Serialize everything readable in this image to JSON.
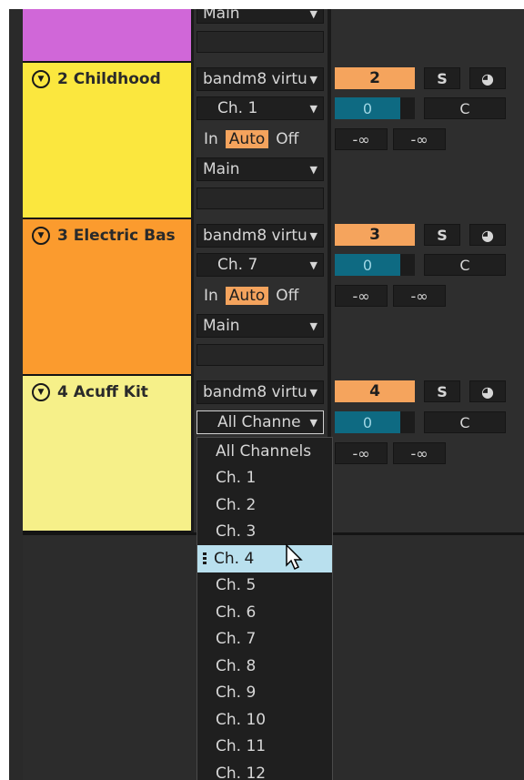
{
  "colors": {
    "track1": "#d067d8",
    "track2": "#fbe73e",
    "track3": "#fb9b2e",
    "track4": "#f6f089",
    "accent": "#f5a45d",
    "volume": "#0e6a82",
    "menu_highlight": "#b9e0ee"
  },
  "track1": {
    "output_value": "Main"
  },
  "tracks": [
    {
      "name": "2 Childhood",
      "input_type": "bandm8 virtu",
      "input_channel": "Ch. 1",
      "monitor": [
        "In",
        "Auto",
        "Off"
      ],
      "output": "Main",
      "number": "2",
      "solo": "S",
      "arm_icon": "record-arm-icon",
      "volume": "0",
      "pan": "C",
      "send_a": "-∞",
      "send_b": "-∞"
    },
    {
      "name": "3 Electric Bas",
      "input_type": "bandm8 virtu",
      "input_channel": "Ch. 7",
      "monitor": [
        "In",
        "Auto",
        "Off"
      ],
      "output": "Main",
      "number": "3",
      "solo": "S",
      "arm_icon": "record-arm-icon",
      "volume": "0",
      "pan": "C",
      "send_a": "-∞",
      "send_b": "-∞"
    },
    {
      "name": "4 Acuff Kit",
      "input_type": "bandm8 virtu",
      "input_channel": "All Channe",
      "number": "4",
      "solo": "S",
      "arm_icon": "record-arm-icon",
      "volume": "0",
      "pan": "C",
      "send_a": "-∞",
      "send_b": "-∞"
    }
  ],
  "channel_menu": {
    "items": [
      "All Channels",
      "Ch. 1",
      "Ch. 2",
      "Ch. 3",
      "Ch. 4",
      "Ch. 5",
      "Ch. 6",
      "Ch. 7",
      "Ch. 8",
      "Ch. 9",
      "Ch. 10",
      "Ch. 11",
      "Ch. 12"
    ],
    "selected": "Ch. 4"
  }
}
